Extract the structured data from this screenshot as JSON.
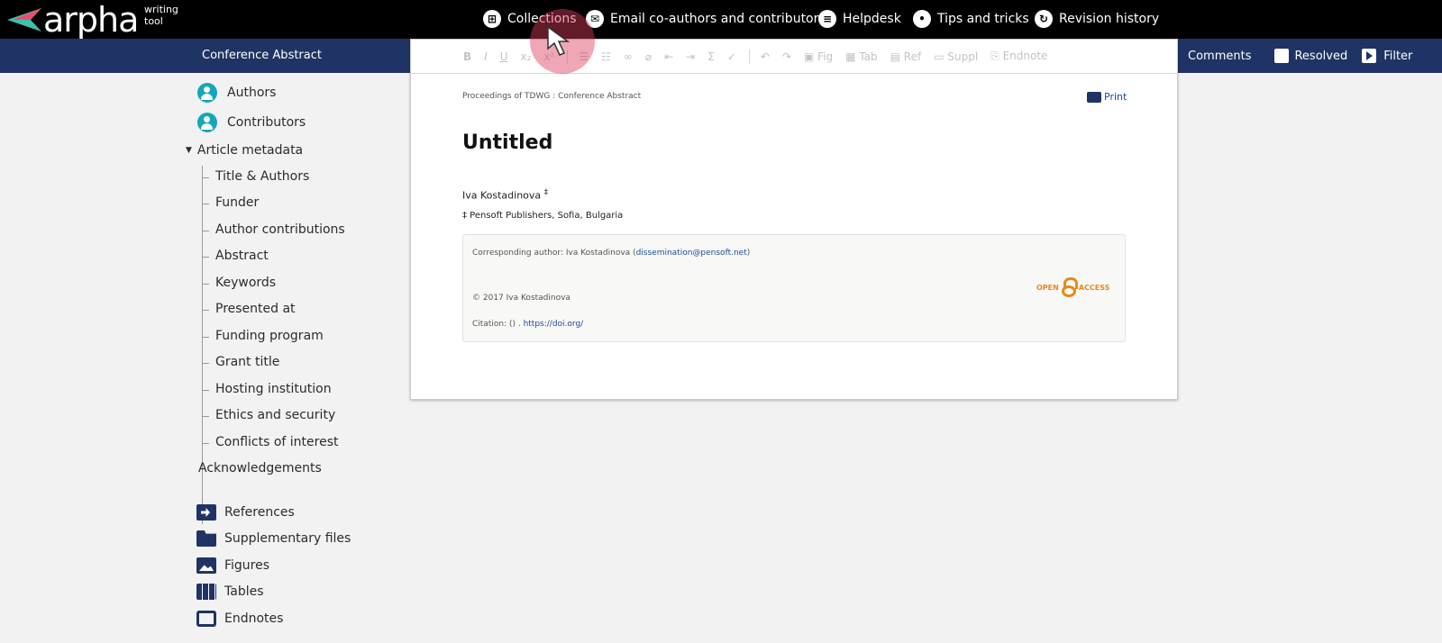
{
  "app": {
    "logo_text": "arpha",
    "logo_subtitle": "writing tool"
  },
  "topnav": {
    "collections": "Collections",
    "email": "Email co-authors and contributors",
    "helpdesk": "Helpdesk",
    "tips": "Tips and tricks",
    "revision": "Revision history"
  },
  "bluebar": {
    "doc_type": "Conference Abstract",
    "comments": "Comments",
    "resolved": "Resolved",
    "filter": "Filter"
  },
  "toolbar": {
    "bold": "B",
    "italic": "I",
    "underline": "U",
    "subscript": "x₂",
    "superscript": "x²",
    "fig": "Fig",
    "tab": "Tab",
    "ref": "Ref",
    "suppl": "Suppl",
    "endnote": "Endnote"
  },
  "document": {
    "journal_line": "Proceedings of TDWG : Conference Abstract",
    "print": "Print",
    "title": "Untitled",
    "author": "Iva Kostadinova",
    "author_mark": "‡",
    "affiliation": "‡ Pensoft Publishers, Sofia, Bulgaria",
    "corr_prefix": "Corresponding author: Iva Kostadinova (",
    "corr_email": "dissemination@pensoft.net",
    "corr_suffix": ")",
    "copyright": "© 2017 Iva Kostadinova",
    "citation_prefix": "Citation: () . ",
    "citation_link": "https://doi.org/",
    "oa_open": "OPEN",
    "oa_access": "ACCESS"
  },
  "sidebar": {
    "authors": "Authors",
    "contributors": "Contributors",
    "article_metadata": "Article metadata",
    "metadata_items": [
      "Title & Authors",
      "Funder",
      "Author contributions",
      "Abstract",
      "Keywords",
      "Presented at",
      "Funding program",
      "Grant title",
      "Hosting institution",
      "Ethics and security",
      "Conflicts of interest"
    ],
    "acknowledgements": "Acknowledgements",
    "references": "References",
    "supplementary": "Supplementary files",
    "figures": "Figures",
    "tables": "Tables",
    "endnotes": "Endnotes"
  }
}
